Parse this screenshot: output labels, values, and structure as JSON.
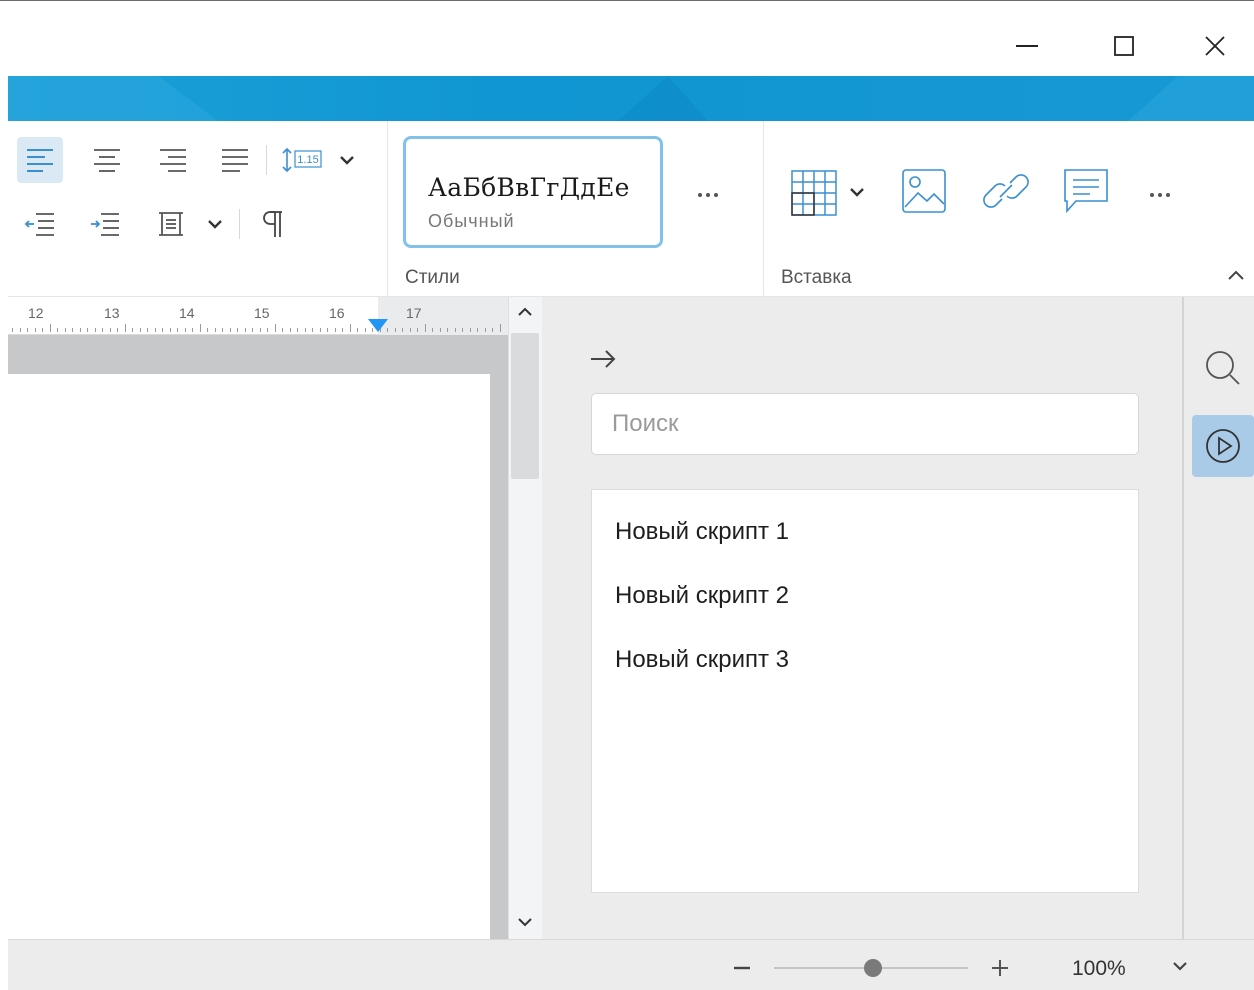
{
  "window": {
    "controls": [
      "minimize-icon",
      "maximize-icon",
      "close-icon"
    ]
  },
  "ribbon": {
    "paragraph_icons": [
      "align-left-icon",
      "align-center-icon",
      "align-right-icon",
      "align-justify-icon",
      "line-spacing-icon",
      "chevron-down-icon",
      "decrease-indent-icon",
      "increase-indent-icon",
      "paragraph-spacing-icon",
      "chevron-down-icon",
      "pilcrow-icon"
    ],
    "line_spacing_value": "1.15",
    "styles": {
      "sample": "АаБбВвГгДдЕе",
      "current": "Обычный",
      "label": "Стили"
    },
    "insert": {
      "label": "Вставка",
      "icons": [
        "table-icon",
        "image-icon",
        "link-icon",
        "comment-icon",
        "more-icon"
      ]
    }
  },
  "ruler": {
    "numbers": [
      "12",
      "13",
      "14",
      "15",
      "16",
      "17"
    ]
  },
  "panel": {
    "search_placeholder": "Поиск",
    "scripts": [
      "Новый скрипт 1",
      "Новый скрипт 2",
      "Новый скрипт 3"
    ]
  },
  "sidebar": {
    "icons": [
      "search-icon",
      "play-icon"
    ]
  },
  "status": {
    "zoom": "100%",
    "zoom_level": 1.0
  },
  "colors": {
    "accent": "#1096d2",
    "active_bg": "#dbe9f5",
    "ruler_marker": "#2196f3"
  }
}
